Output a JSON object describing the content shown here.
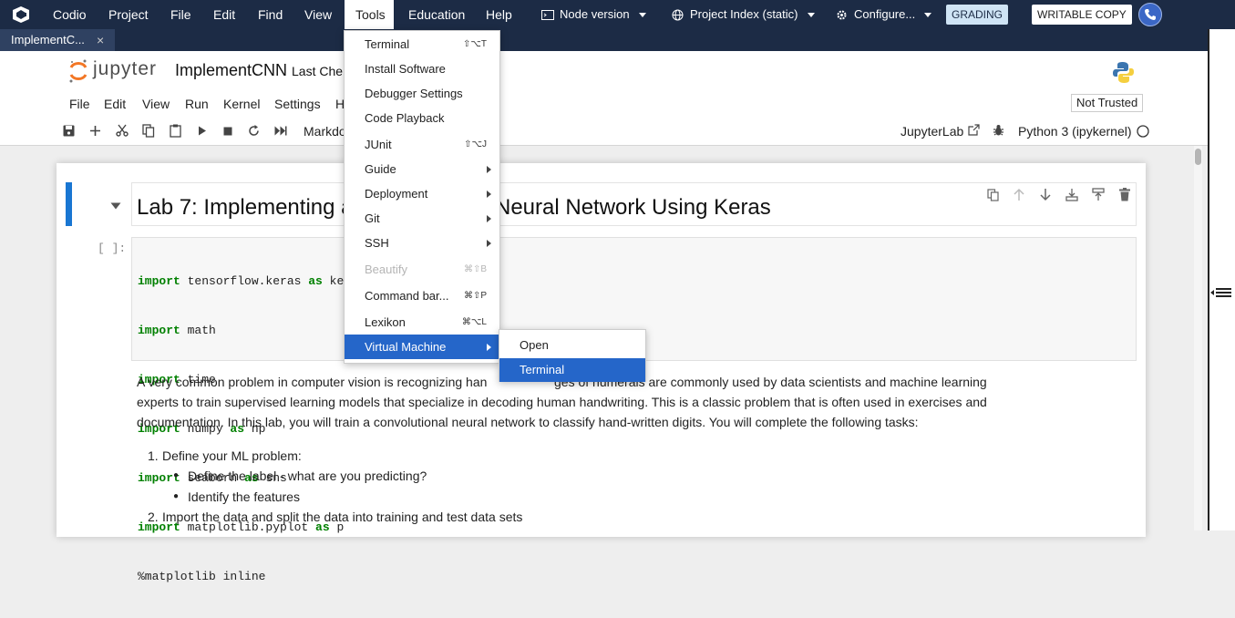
{
  "codio": {
    "menu": [
      "Codio",
      "Project",
      "File",
      "Edit",
      "Find",
      "View",
      "Tools",
      "Education",
      "Help"
    ],
    "node_version": "Node version",
    "project_index": "Project Index (static)",
    "configure": "Configure...",
    "grading": "GRADING",
    "writable_copy": "WRITABLE COPY"
  },
  "tab": {
    "label": "ImplementC...",
    "close": "×"
  },
  "jupyter": {
    "logo_text": "jupyter",
    "notebook_title": "ImplementCNN",
    "last_checkpoint": "Last Che",
    "menu": [
      "File",
      "Edit",
      "View",
      "Run",
      "Kernel",
      "Settings",
      "H"
    ],
    "not_trusted": "Not Trusted",
    "cell_type": "Markdo",
    "jupyterlab": "JupyterLab",
    "kernel": "Python 3 (ipykernel)"
  },
  "cells": {
    "heading_left": "Lab 7: Implementing a",
    "heading_right": "Neural Network Using Keras",
    "prompt": "[ ]:",
    "code_lines": [
      {
        "kw": "import",
        "rest": " tensorflow.keras ",
        "kw2": "as",
        "rest2": " ke"
      },
      {
        "kw": "import",
        "rest": " math",
        "kw2": "",
        "rest2": ""
      },
      {
        "kw": "import",
        "rest": " time",
        "kw2": "",
        "rest2": ""
      },
      {
        "kw": "import",
        "rest": " numpy ",
        "kw2": "as",
        "rest2": " np"
      },
      {
        "kw": "import",
        "rest": " seaborn ",
        "kw2": "as",
        "rest2": " sns"
      },
      {
        "kw": "import",
        "rest": " matplotlib.pyplot ",
        "kw2": "as",
        "rest2": " p"
      },
      {
        "kw": "",
        "rest": "%matplotlib inline",
        "kw2": "",
        "rest2": ""
      }
    ],
    "md_line1_left": "A very common problem in computer vision is recognizing han",
    "md_line1_right": "ges of numerals are commonly used by data scientists and machine learning",
    "md_line2": "experts to train supervised learning models that specialize in decoding human handwriting. This is a classic problem that is often used in exercises and",
    "md_line3": "documentation. In this lab, you will train a convolutional neural network to classify hand-written digits. You will complete the following tasks:",
    "list1": "Define your ML problem:",
    "list1_num": "1.",
    "sub1": "Define the label - what are you predicting?",
    "sub2": "Identify the features",
    "list2": "Import the data and split the data into training and test data sets",
    "list2_num": "2."
  },
  "tools_menu": [
    {
      "label": "Terminal",
      "shortcut": "⇧⌥T",
      "submenu": false,
      "disabled": false
    },
    {
      "label": "Install Software",
      "shortcut": "",
      "submenu": false,
      "disabled": false
    },
    {
      "label": "Debugger Settings",
      "shortcut": "",
      "submenu": false,
      "disabled": false
    },
    {
      "label": "Code Playback",
      "shortcut": "",
      "submenu": false,
      "disabled": false
    },
    {
      "label": "JUnit",
      "shortcut": "⇧⌥J",
      "submenu": false,
      "disabled": false
    },
    {
      "label": "Guide",
      "shortcut": "",
      "submenu": true,
      "disabled": false
    },
    {
      "label": "Deployment",
      "shortcut": "",
      "submenu": true,
      "disabled": false
    },
    {
      "label": "Git",
      "shortcut": "",
      "submenu": true,
      "disabled": false
    },
    {
      "label": "SSH",
      "shortcut": "",
      "submenu": true,
      "disabled": false
    },
    {
      "label": "Beautify",
      "shortcut": "⌘⇧B",
      "submenu": false,
      "disabled": true
    },
    {
      "label": "Command bar...",
      "shortcut": "⌘⇧P",
      "submenu": false,
      "disabled": false
    },
    {
      "label": "Lexikon",
      "shortcut": "⌘⌥L",
      "submenu": false,
      "disabled": false
    },
    {
      "label": "Virtual Machine",
      "shortcut": "",
      "submenu": true,
      "disabled": false
    }
  ],
  "vm_submenu": [
    "Open",
    "Terminal"
  ],
  "colors": {
    "codio_bar": "#1c2b45",
    "menu_active": "#2566c9",
    "keyword": "#008000",
    "cell_marker": "#1976d2",
    "grading_bg": "#cfe4f5"
  },
  "icons": [
    "save-icon",
    "add-cell-icon",
    "cut-icon",
    "copy-icon",
    "paste-icon",
    "run-icon",
    "stop-icon",
    "restart-icon",
    "fast-forward-icon",
    "external-link-icon",
    "bug-icon",
    "kernel-status-icon",
    "phone-icon",
    "python-logo-icon"
  ]
}
